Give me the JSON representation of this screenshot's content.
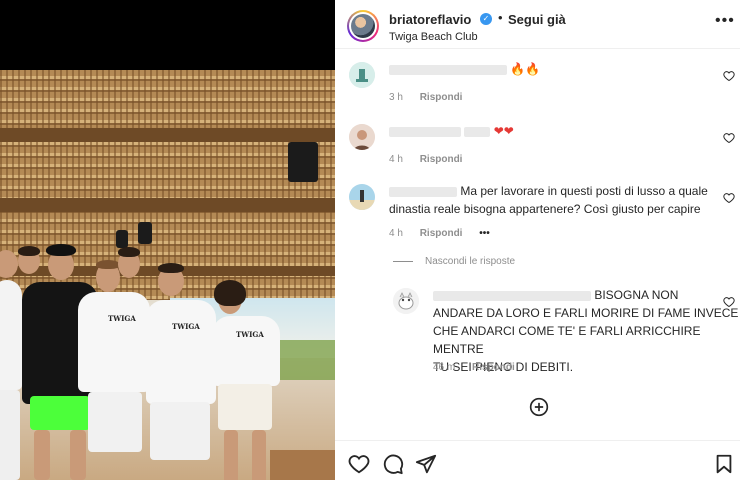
{
  "post": {
    "username": "briatoreflavio",
    "separator": "•",
    "follow_label": "Segui già",
    "location": "Twiga Beach Club",
    "more_label": "•••",
    "shirt_text": "TWIGA"
  },
  "comments": [
    {
      "user_suffix": "",
      "text": "",
      "emoji": "🔥🔥",
      "time": "3 h",
      "reply_label": "Rispondi"
    },
    {
      "user_suffix": "",
      "text": "",
      "emoji": "❤❤",
      "time": "4 h",
      "reply_label": "Rispondi"
    },
    {
      "user_suffix": "",
      "text": "Ma per lavorare in questi posti di lusso a quale",
      "text2": "dinastia reale bisogna appartenere? Così giusto per capire",
      "time": "4 h",
      "reply_label": "Rispondi",
      "more_label": "•••"
    }
  ],
  "hide_replies_label": "Nascondi le risposte",
  "reply": {
    "line1": "BISOGNA NON",
    "line2": "ANDARE DA LORO E FARLI MORIRE DI FAME INVECE",
    "line3": "CHE ANDARCI COME TE' E FARLI ARRICCHIRE MENTRE",
    "line4": "TU SEI PIENO DI DEBITI.",
    "time": "46 m",
    "reply_label": "Rispondi"
  },
  "colors": {
    "verified": "#3897f0",
    "heart": "#e53935",
    "muted": "#8e8e8e"
  },
  "icons": [
    "verified-icon",
    "more-icon",
    "heart-icon",
    "add-comment-icon",
    "like-icon",
    "comment-icon",
    "share-icon",
    "save-icon"
  ]
}
